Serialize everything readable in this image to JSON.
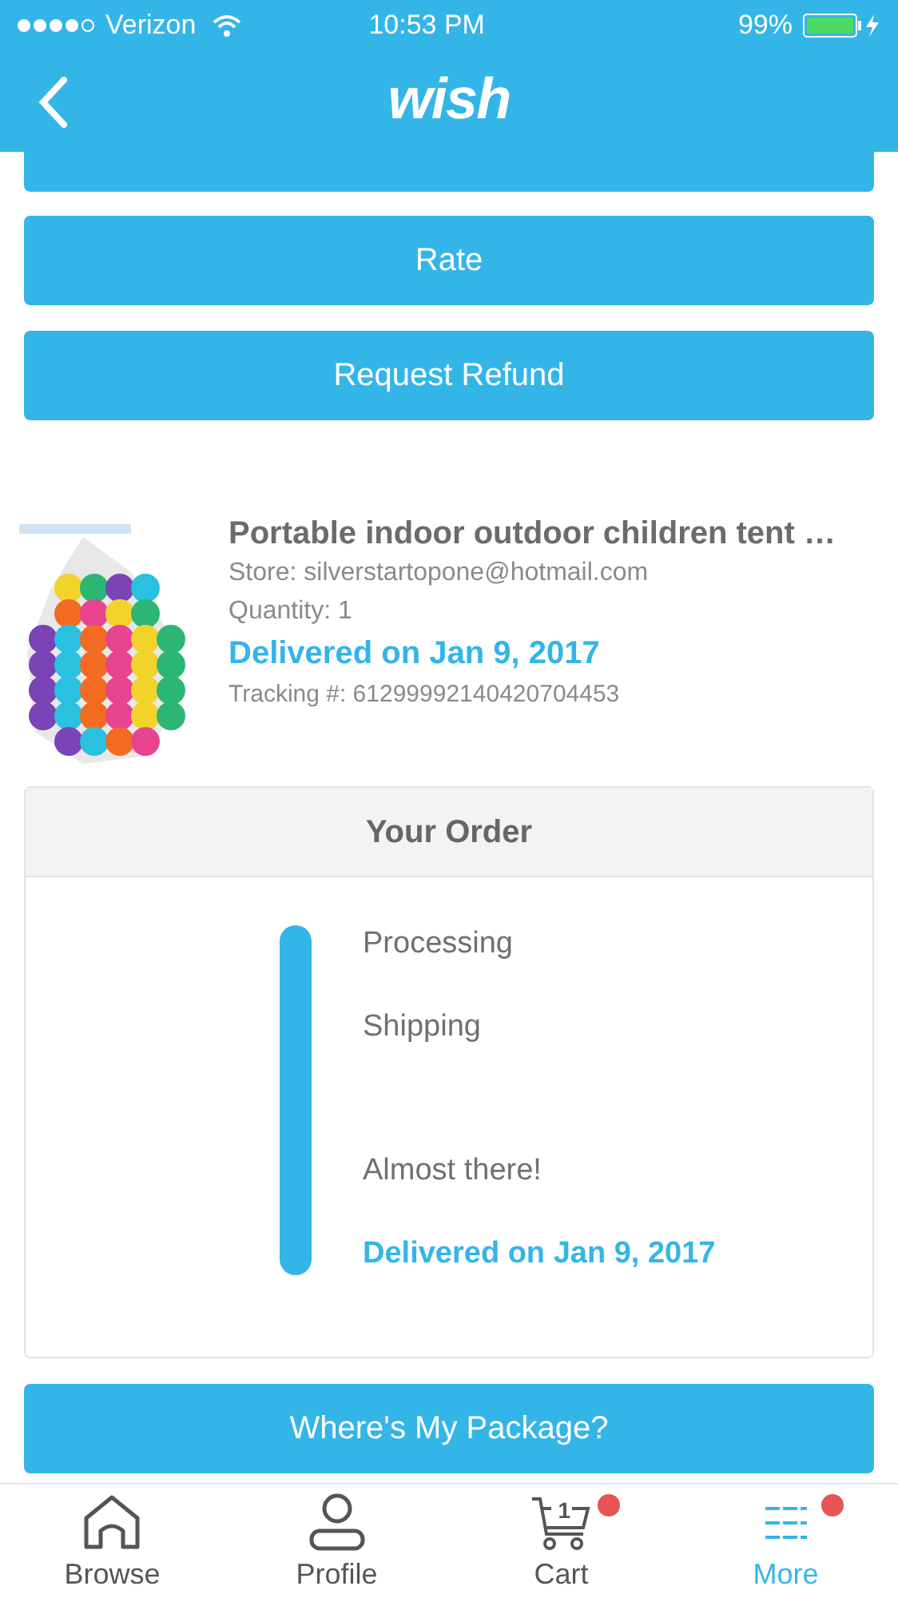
{
  "status_bar": {
    "carrier": "Verizon",
    "time": "10:53 PM",
    "battery": "99%"
  },
  "header": {
    "logo": "wish"
  },
  "actions": [
    "Rate",
    "Request Refund"
  ],
  "product": {
    "kind": "picture",
    "title": "Portable indoor outdoor children tent …",
    "store": "Store: silverstartopone@hotmail.com",
    "quantity": "Quantity: 1",
    "status": "Delivered on Jan 9, 2017",
    "tracking": "Tracking #: 61299992140420704453"
  },
  "order": {
    "title": "Your Order",
    "steps": [
      {
        "label": "Processing",
        "current": false
      },
      {
        "label": "Shipping",
        "current": false
      },
      {
        "label": "Almost there!",
        "current": false
      },
      {
        "label": "Delivered on Jan 9, 2017",
        "current": true
      }
    ]
  },
  "package_button": "Where's My Package?",
  "tabs": [
    {
      "label": "Browse",
      "selected": false
    },
    {
      "label": "Profile",
      "selected": false
    },
    {
      "label": "Cart",
      "count": "1",
      "badge": true,
      "selected": false
    },
    {
      "label": "More",
      "badge": true,
      "selected": true
    }
  ]
}
